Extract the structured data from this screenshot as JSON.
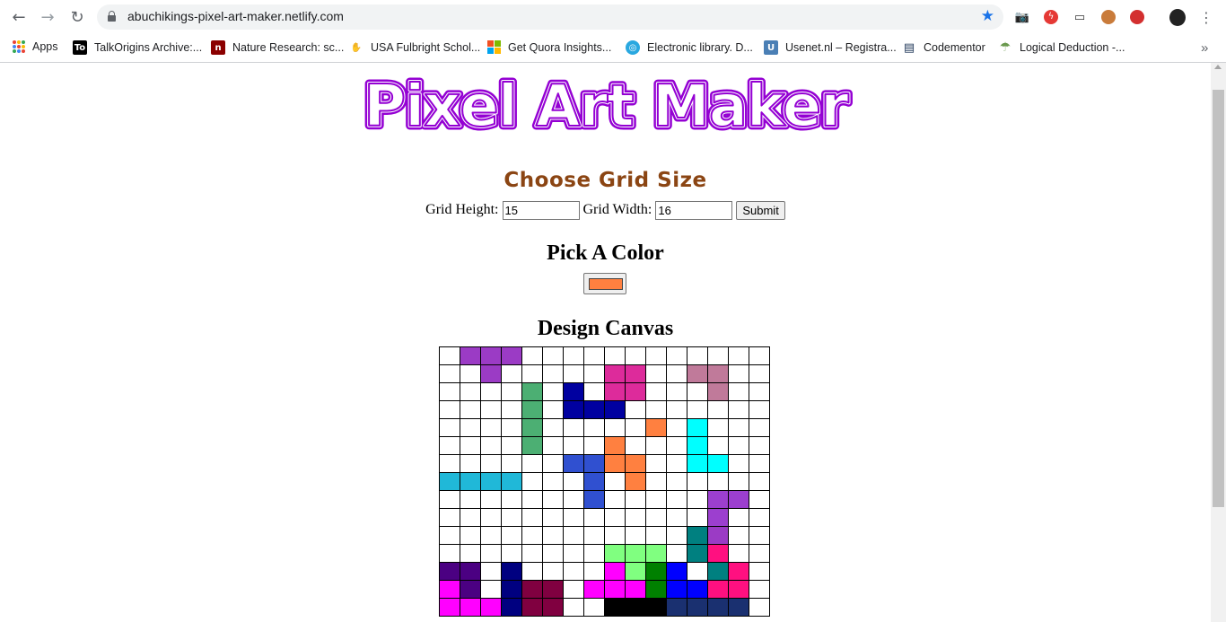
{
  "browser": {
    "url": "abuchikings-pixel-art-maker.netlify.com",
    "nav_icons": [
      "back-arrow-icon",
      "forward-arrow-icon",
      "reload-icon"
    ],
    "bookmarks": [
      {
        "label": "Apps",
        "icon": "apps-grid-icon"
      },
      {
        "label": "TalkOrigins Archive:...",
        "icon": "talkorigins-icon",
        "glyph": "To",
        "color": "#000000"
      },
      {
        "label": "Nature Research: sc...",
        "icon": "nature-icon",
        "glyph": "n",
        "color": "#8b0000"
      },
      {
        "label": "USA Fulbright Schol...",
        "icon": "fulbright-icon",
        "glyph": "✋",
        "color": "#ffffff"
      },
      {
        "label": "Get Quora Insights...",
        "icon": "microsoft-icon",
        "glyph": "",
        "color": "#f25022"
      },
      {
        "label": "Electronic library. D...",
        "icon": "library-icon",
        "glyph": "◎",
        "color": "#29a8e0"
      },
      {
        "label": "Usenet.nl – Registra...",
        "icon": "usenet-icon",
        "glyph": "U",
        "color": "#4a7fb5"
      },
      {
        "label": "Codementor",
        "icon": "codementor-icon",
        "glyph": "▤",
        "color": "#1d3557"
      },
      {
        "label": "Logical Deduction -...",
        "icon": "umbrella-icon",
        "glyph": "☂",
        "color": "#6a994e"
      }
    ],
    "more_bookmarks": "»"
  },
  "page": {
    "logo_text": "Pixel Art Maker",
    "logo_color": "#9400d3",
    "grid_section_title": "Choose Grid Size",
    "grid_title_color": "#8b4513",
    "height_label": "Grid Height:",
    "height_value": "15",
    "width_label": "Grid Width:",
    "width_value": "16",
    "submit_label": "Submit",
    "color_section_title": "Pick A Color",
    "selected_color": "#ff8040",
    "canvas_title": "Design Canvas"
  },
  "canvas": {
    "rows": 15,
    "cols": 16,
    "palette": {
      "P": "#9b3bc5",
      "M": "#dd2b9b",
      "R": "#c07a9a",
      "G": "#4caf73",
      "N": "#0000a0",
      "O": "#ff8040",
      "C": "#00ffff",
      "B": "#3050d0",
      "T": "#20b8d8",
      "L": "#9c3fcf",
      "E": "#008080",
      "K": "#ff1080",
      "Q": "#80ff80",
      "V": "#4b0082",
      "D": "#000080",
      "F": "#ff00ff",
      "A": "#008000",
      "U": "#0000ff",
      "W": "#800040",
      "Z": "#000000",
      "Y": "#1a3070"
    },
    "cells": [
      ".PPP............",
      "..P.....MM..RR..",
      "....G.N.MM...R..",
      "....G.NNN.......",
      "....G.....O.C...",
      "....G...O...C...",
      "......BBOO..CC..",
      "TTTT...B.O......",
      ".......B.....LL.",
      ".............L..",
      "............EP..",
      "........QQQ.EK..",
      "VV.D....FQAU.EK.",
      "FV.DWW.FFFAUUKK.",
      "FFFDWW..ZZZYYYY."
    ]
  }
}
